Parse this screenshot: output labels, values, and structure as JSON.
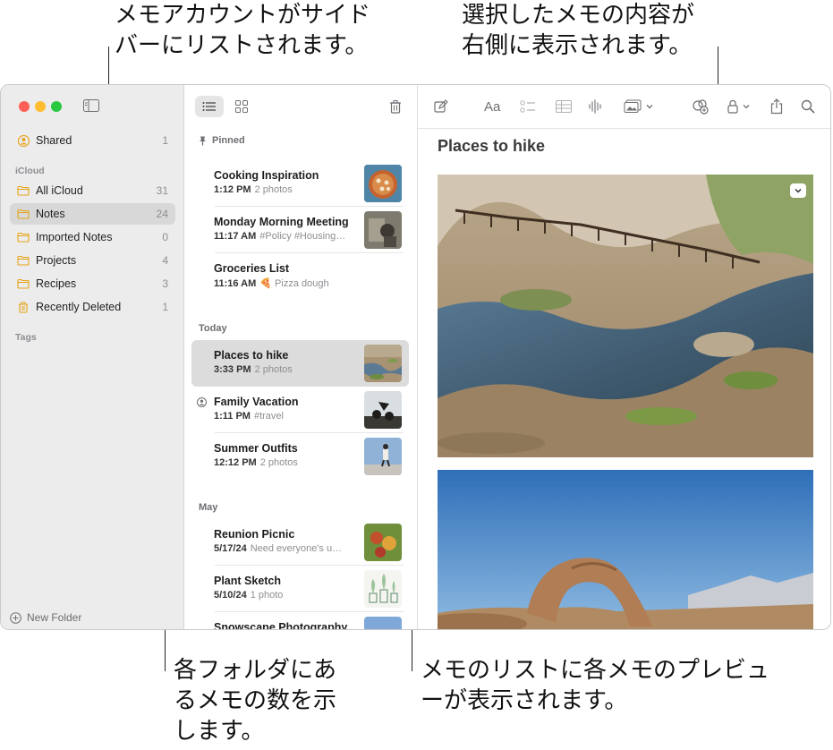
{
  "callouts": {
    "top_left": "メモアカウントがサイド\nバーにリストされます。",
    "top_right": "選択したメモの内容が\n右側に表示されます。",
    "bottom_left": "各フォルダにあ\nるメモの数を示\nします。",
    "bottom_right": "メモのリストに各メモのプレビュ\nーが表示されます。"
  },
  "sidebar": {
    "shared": {
      "label": "Shared",
      "count": "1"
    },
    "icloud_header": "iCloud",
    "folders": [
      {
        "label": "All iCloud",
        "count": "31"
      },
      {
        "label": "Notes",
        "count": "24"
      },
      {
        "label": "Imported Notes",
        "count": "0"
      },
      {
        "label": "Projects",
        "count": "4"
      },
      {
        "label": "Recipes",
        "count": "3"
      },
      {
        "label": "Recently Deleted",
        "count": "1"
      }
    ],
    "tags_header": "Tags",
    "new_folder": "New Folder"
  },
  "note_list": {
    "groups": {
      "pinned": "Pinned",
      "today": "Today",
      "may": "May"
    },
    "notes": [
      {
        "title": "Cooking Inspiration",
        "time": "1:12 PM",
        "sub": "2 photos"
      },
      {
        "title": "Monday Morning Meeting",
        "time": "11:17 AM",
        "sub": "#Policy #Housing…"
      },
      {
        "title": "Groceries List",
        "time": "11:16 AM",
        "sub": "🍕 Pizza dough"
      },
      {
        "title": "Places to hike",
        "time": "3:33 PM",
        "sub": "2 photos"
      },
      {
        "title": "Family Vacation",
        "time": "1:11 PM",
        "sub": "#travel"
      },
      {
        "title": "Summer Outfits",
        "time": "12:12 PM",
        "sub": "2 photos"
      },
      {
        "title": "Reunion Picnic",
        "time": "5/17/24",
        "sub": "Need everyone's u…"
      },
      {
        "title": "Plant Sketch",
        "time": "5/10/24",
        "sub": "1 photo"
      },
      {
        "title": "Snowscape Photography",
        "time": "",
        "sub": ""
      }
    ]
  },
  "editor": {
    "note_title": "Places to hike",
    "format_label": "Aa"
  }
}
